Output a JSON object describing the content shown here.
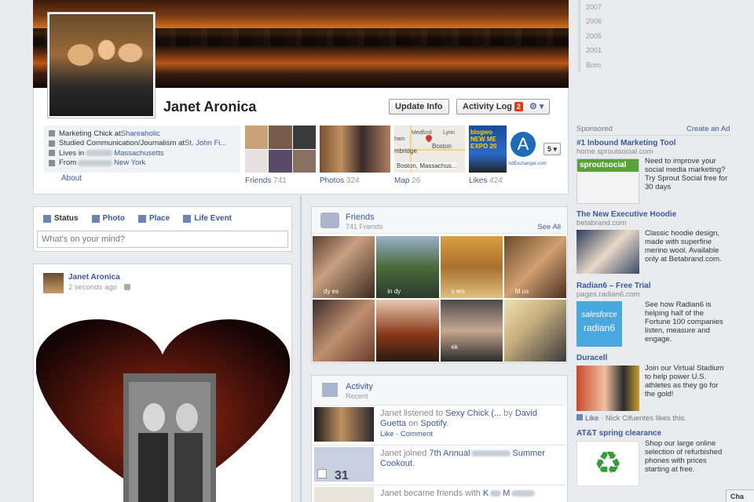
{
  "profile": {
    "name": "Janet Aronica",
    "update_info": "Update Info",
    "activity_log": "Activity Log",
    "activity_count": "2",
    "settings_caret": "⚙ ▾",
    "info": {
      "work_prefix": "Marketing Chick at ",
      "work_link": "Shareaholic",
      "study_prefix": "Studied Communication/Journalism at ",
      "study_link": "St. John Fi...",
      "lives_prefix": "Lives in ",
      "lives_link": "Massachusetts",
      "from_prefix": "From ",
      "from_link": "New York"
    },
    "about": "About",
    "tiles": [
      {
        "label": "Friends",
        "count": "741"
      },
      {
        "label": "Photos",
        "count": "324"
      },
      {
        "label": "Map",
        "count": "26"
      },
      {
        "label": "Likes",
        "count": "424"
      }
    ],
    "more_count": "5 ▾",
    "map_caption": "Boston, Massachus...",
    "map_labels": {
      "a": "Medford",
      "b": "Lynn",
      "c": "ham",
      "d": "mbridge",
      "e": "Boston"
    },
    "likes_letter": "A",
    "likes_caption": "AdExchanger.com",
    "blog_text": "blogwo NEW ME EXPO 20"
  },
  "timeline_years": [
    "2007",
    "2006",
    "2005",
    "2001",
    "Born"
  ],
  "composer": {
    "tabs": [
      "Status",
      "Photo",
      "Place",
      "Life Event"
    ],
    "placeholder": "What's on your mind?"
  },
  "post": {
    "author": "Janet Aronica",
    "time": "2 seconds ago"
  },
  "friends": {
    "title": "Friends",
    "count": "741 Friends",
    "see_all": "See All",
    "tile_captions": [
      "dy  es",
      "in  dy",
      "s  ers",
      "M  us",
      "",
      "",
      "ek",
      ""
    ]
  },
  "activity": {
    "title": "Activity",
    "subtitle": "Recent",
    "items": [
      {
        "p1": "Janet listened to ",
        "l1": "Sexy Chick (...",
        "p2": " by ",
        "l2": "David Guetta",
        "p3": " on ",
        "l3": "Spotify",
        "p4": ".",
        "actions": "Like · Comment"
      },
      {
        "p1": "Janet joined ",
        "l1": "7th Annual",
        "l2": "Summer Cookout",
        "p2": "."
      },
      {
        "p1": "Janet became friends with ",
        "l1": "K",
        "l2": "M"
      }
    ],
    "calendar_day": "31"
  },
  "sponsored": {
    "label": "Sponsored",
    "create_ad": "Create an Ad",
    "ads": [
      {
        "title": "#1 Inbound Marketing Tool",
        "url": "home.sproutsocial.com",
        "body": "Need to improve your social media marketing? Try Sprout Social free for 30 days",
        "logo": "sproutsocial"
      },
      {
        "title": "The New Executive Hoodie",
        "url": "betabrand.com",
        "body": "Classic hoodie design, made with superfine merino wool. Available only at Betabrand.com."
      },
      {
        "title": "Radian6 – Free Trial",
        "url": "pages.radian6.com",
        "body": "See how Radian6 is helping half of the Fortune 100 companies listen, measure and engage.",
        "logo1": "salesforce",
        "logo2": "radian6"
      },
      {
        "title": "Duracell",
        "url": "",
        "body": "Join our Virtual Stadium to help power U.S. athletes as they go for the gold!",
        "like": "Like",
        "social": " · Nick Cifuentes likes this."
      },
      {
        "title": "AT&T spring clearance",
        "url": "",
        "body": "Shop our large online selection of refurbished phones with prices starting at free."
      }
    ]
  },
  "chat": "Cha"
}
